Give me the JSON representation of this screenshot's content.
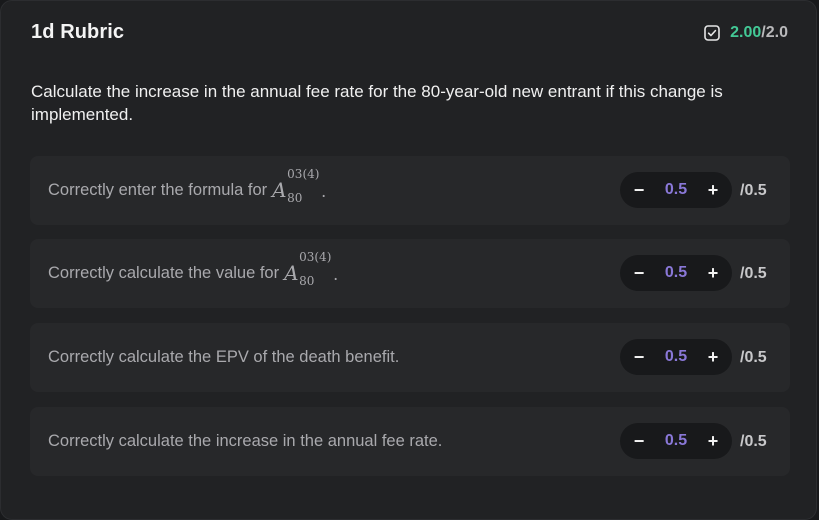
{
  "header": {
    "title": "1d Rubric",
    "score_earned": "2.00",
    "score_sep": "/",
    "score_total": "2.0",
    "score_icon": "checkbox-checked-icon",
    "accent_color": "#43c996"
  },
  "question": "Calculate the increase in the annual fee rate for the 80-year-old new entrant if this change is implemented.",
  "math": {
    "base": "A",
    "sup": "03(4)",
    "sub": "80",
    "dot": "."
  },
  "criteria": [
    {
      "label": "Correctly enter the formula for",
      "has_math": true,
      "minus": "−",
      "value": "0.5",
      "plus": "+",
      "max": "/0.5"
    },
    {
      "label": "Correctly calculate the value for",
      "has_math": true,
      "minus": "−",
      "value": "0.5",
      "plus": "+",
      "max": "/0.5"
    },
    {
      "label": "Correctly calculate the EPV of the death benefit.",
      "has_math": false,
      "minus": "−",
      "value": "0.5",
      "plus": "+",
      "max": "/0.5"
    },
    {
      "label": "Correctly calculate the increase in the annual fee rate.",
      "has_math": false,
      "minus": "−",
      "value": "0.5",
      "plus": "+",
      "max": "/0.5"
    }
  ],
  "colors": {
    "value": "#8a78d8",
    "card_bg": "#27282a",
    "stepper_bg": "#18191b"
  }
}
